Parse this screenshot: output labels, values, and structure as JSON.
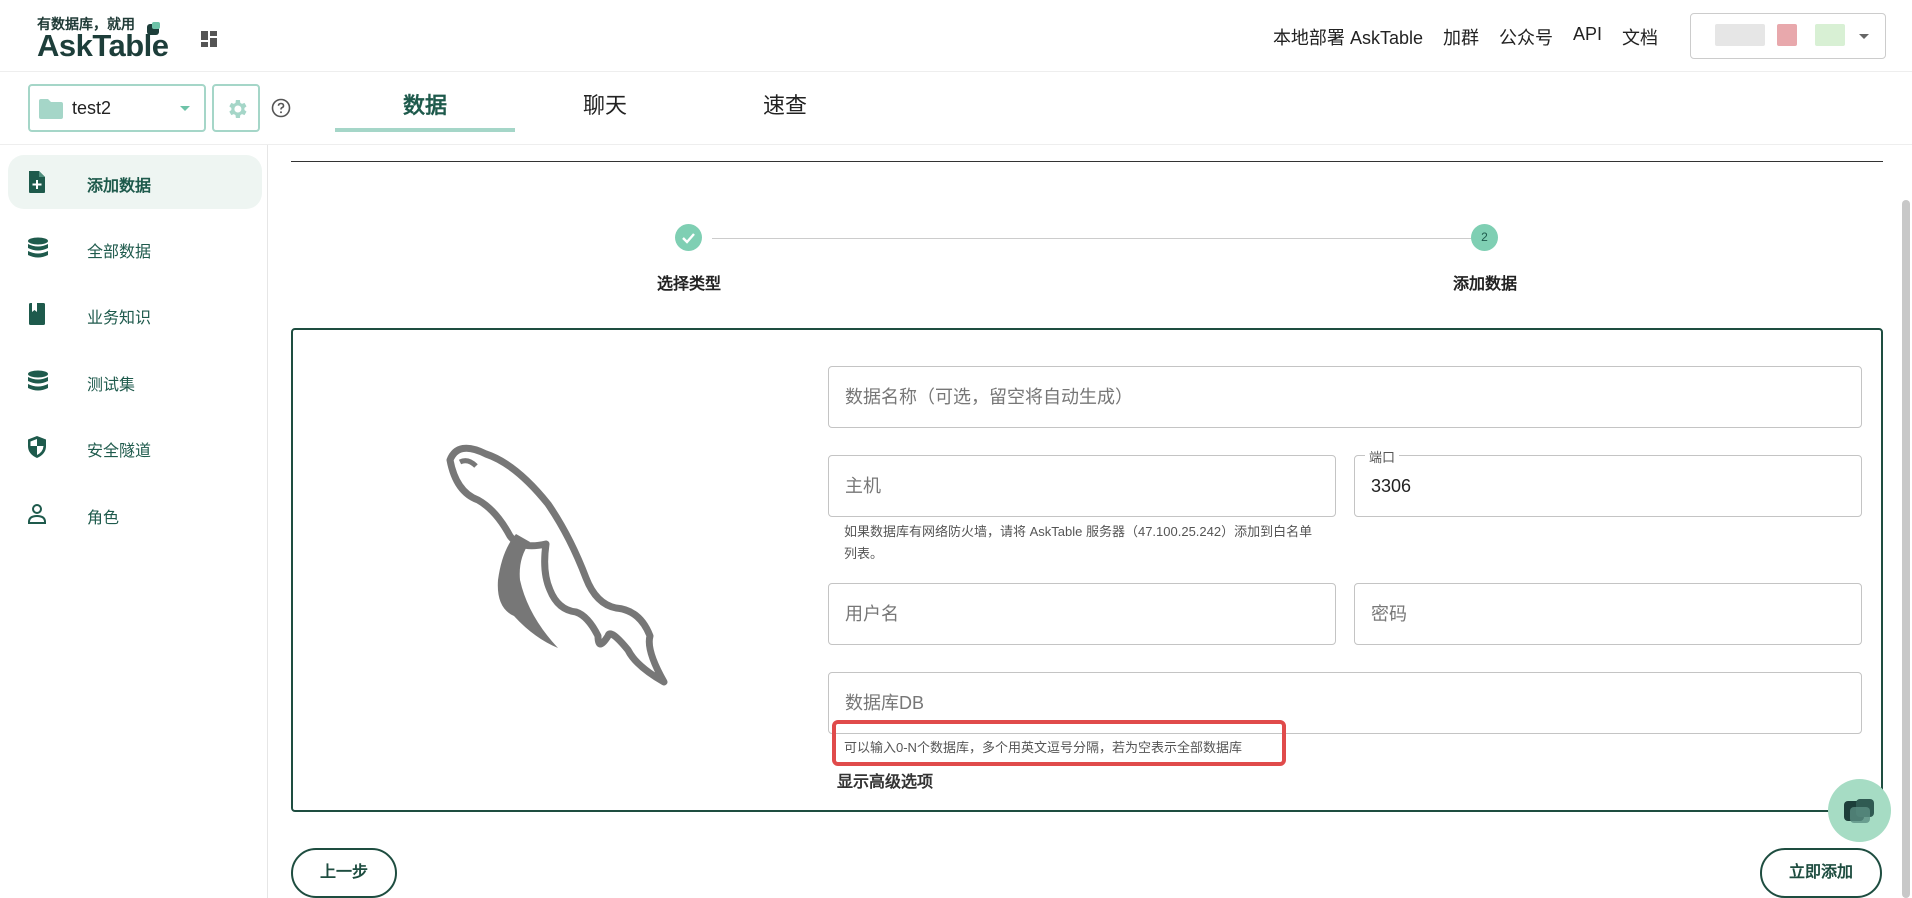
{
  "header": {
    "logo_tagline": "有数据库，就用",
    "logo_name": "AskTable",
    "nav": [
      "本地部署 AskTable",
      "加群",
      "公众号",
      "API",
      "文档"
    ]
  },
  "project": {
    "name": "test2"
  },
  "tabs": [
    {
      "label": "数据",
      "active": true
    },
    {
      "label": "聊天",
      "active": false
    },
    {
      "label": "速查",
      "active": false
    }
  ],
  "sidebar": {
    "items": [
      {
        "label": "添加数据",
        "icon": "add-file-icon",
        "active": true
      },
      {
        "label": "全部数据",
        "icon": "database-icon",
        "active": false
      },
      {
        "label": "业务知识",
        "icon": "book-icon",
        "active": false
      },
      {
        "label": "测试集",
        "icon": "database-icon",
        "active": false
      },
      {
        "label": "安全隧道",
        "icon": "shield-icon",
        "active": false
      },
      {
        "label": "角色",
        "icon": "person-icon",
        "active": false
      }
    ]
  },
  "stepper": {
    "steps": [
      {
        "label": "选择类型",
        "state": "done"
      },
      {
        "label": "添加数据",
        "number": "2",
        "state": "active"
      }
    ]
  },
  "form": {
    "name_placeholder": "数据名称（可选，留空将自动生成）",
    "host_placeholder": "主机",
    "host_helper": "如果数据库有网络防火墙，请将 AskTable 服务器（47.100.25.242）添加到白名单列表。",
    "port_label": "端口",
    "port_value": "3306",
    "username_placeholder": "用户名",
    "password_placeholder": "密码",
    "db_placeholder": "数据库DB",
    "db_helper": "可以输入0-N个数据库，多个用英文逗号分隔，若为空表示全部数据库",
    "advanced_label": "显示高级选项"
  },
  "actions": {
    "prev_label": "上一步",
    "submit_label": "立即添加"
  },
  "colors": {
    "accent": "#1e5a4c",
    "accent_light": "#a5d6c8",
    "highlight": "#e04b4b"
  }
}
